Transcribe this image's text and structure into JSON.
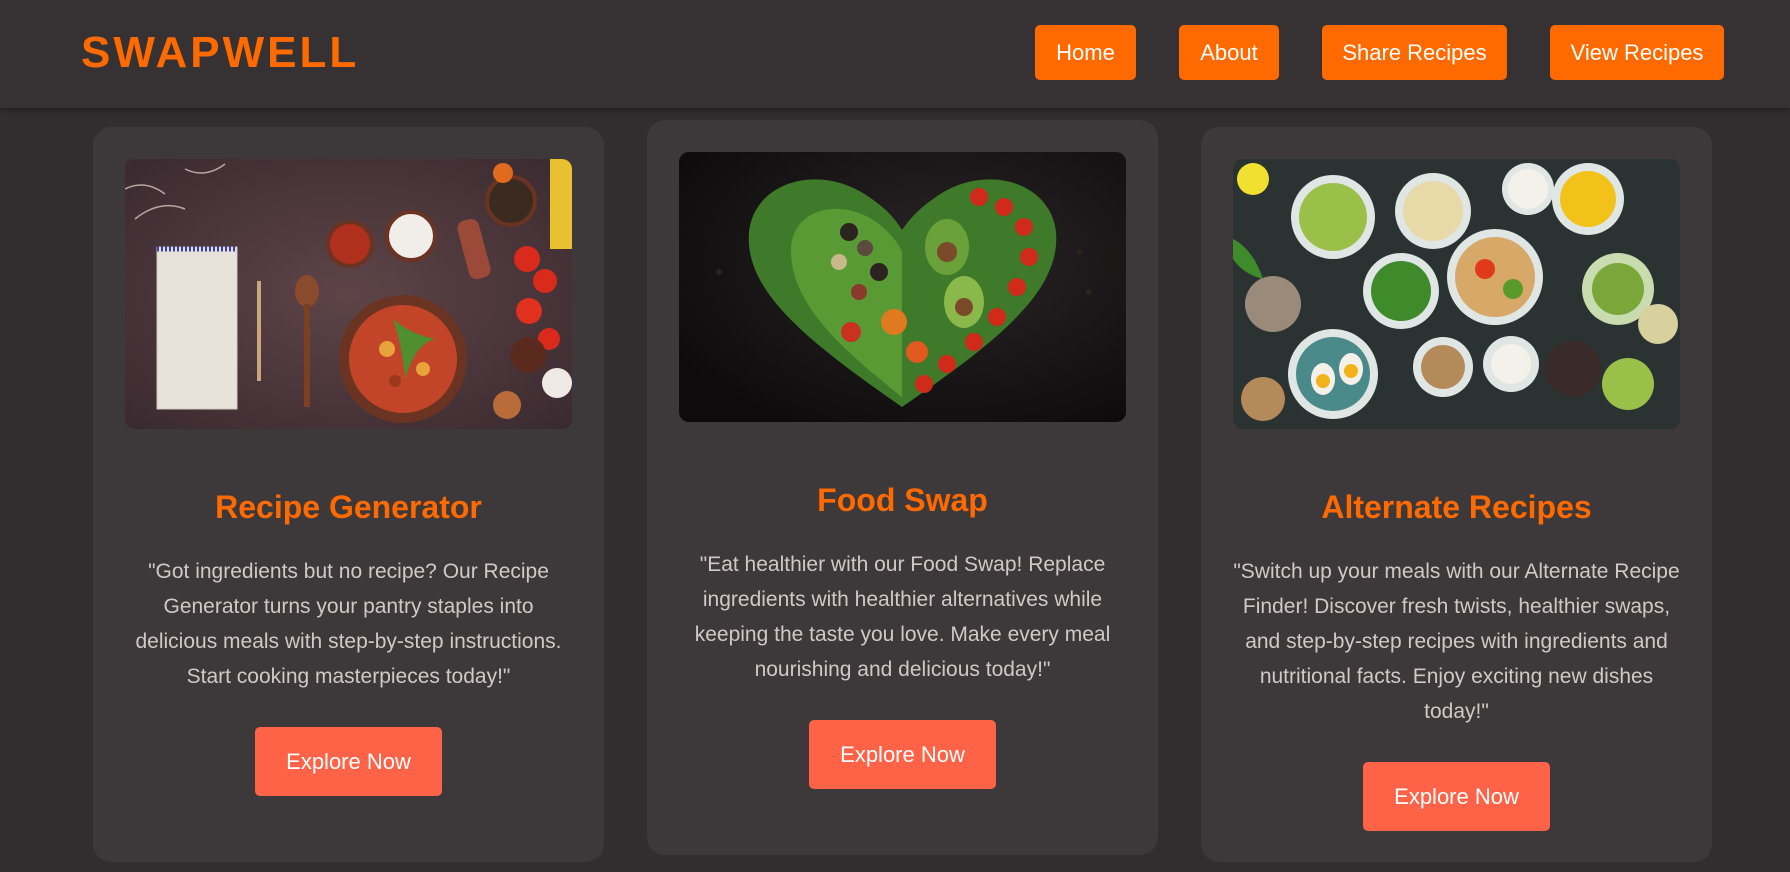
{
  "brand": {
    "name": "SWAPWELL",
    "accent_color": "#ff6a00"
  },
  "nav": {
    "items": [
      {
        "label": "Home"
      },
      {
        "label": "About"
      },
      {
        "label": "Share Recipes"
      },
      {
        "label": "View Recipes"
      }
    ]
  },
  "cards": [
    {
      "image": "recipe-ingredients-photo",
      "title": "Recipe Generator",
      "description": "\"Got ingredients but no recipe? Our Recipe Generator turns your pantry staples into delicious meals with step-by-step instructions. Start cooking masterpieces today!\"",
      "button_label": "Explore Now"
    },
    {
      "image": "heart-shaped-vegetables-photo",
      "title": "Food Swap",
      "description": "\"Eat healthier with our Food Swap! Replace ingredients with healthier alternatives while keeping the taste you love. Make every meal nourishing and delicious today!\"",
      "button_label": "Explore Now"
    },
    {
      "image": "healthy-bowls-photo",
      "title": "Alternate Recipes",
      "description": "\"Switch up your meals with our Alternate Recipe Finder! Discover fresh twists, healthier swaps, and step-by-step recipes with ingredients and nutritional facts. Enjoy exciting new dishes today!\"",
      "button_label": "Explore Now"
    }
  ],
  "colors": {
    "background": "#322e2f",
    "card_background": "#3d3839",
    "nav_button": "#ff6a00",
    "explore_button": "#ff6347"
  }
}
